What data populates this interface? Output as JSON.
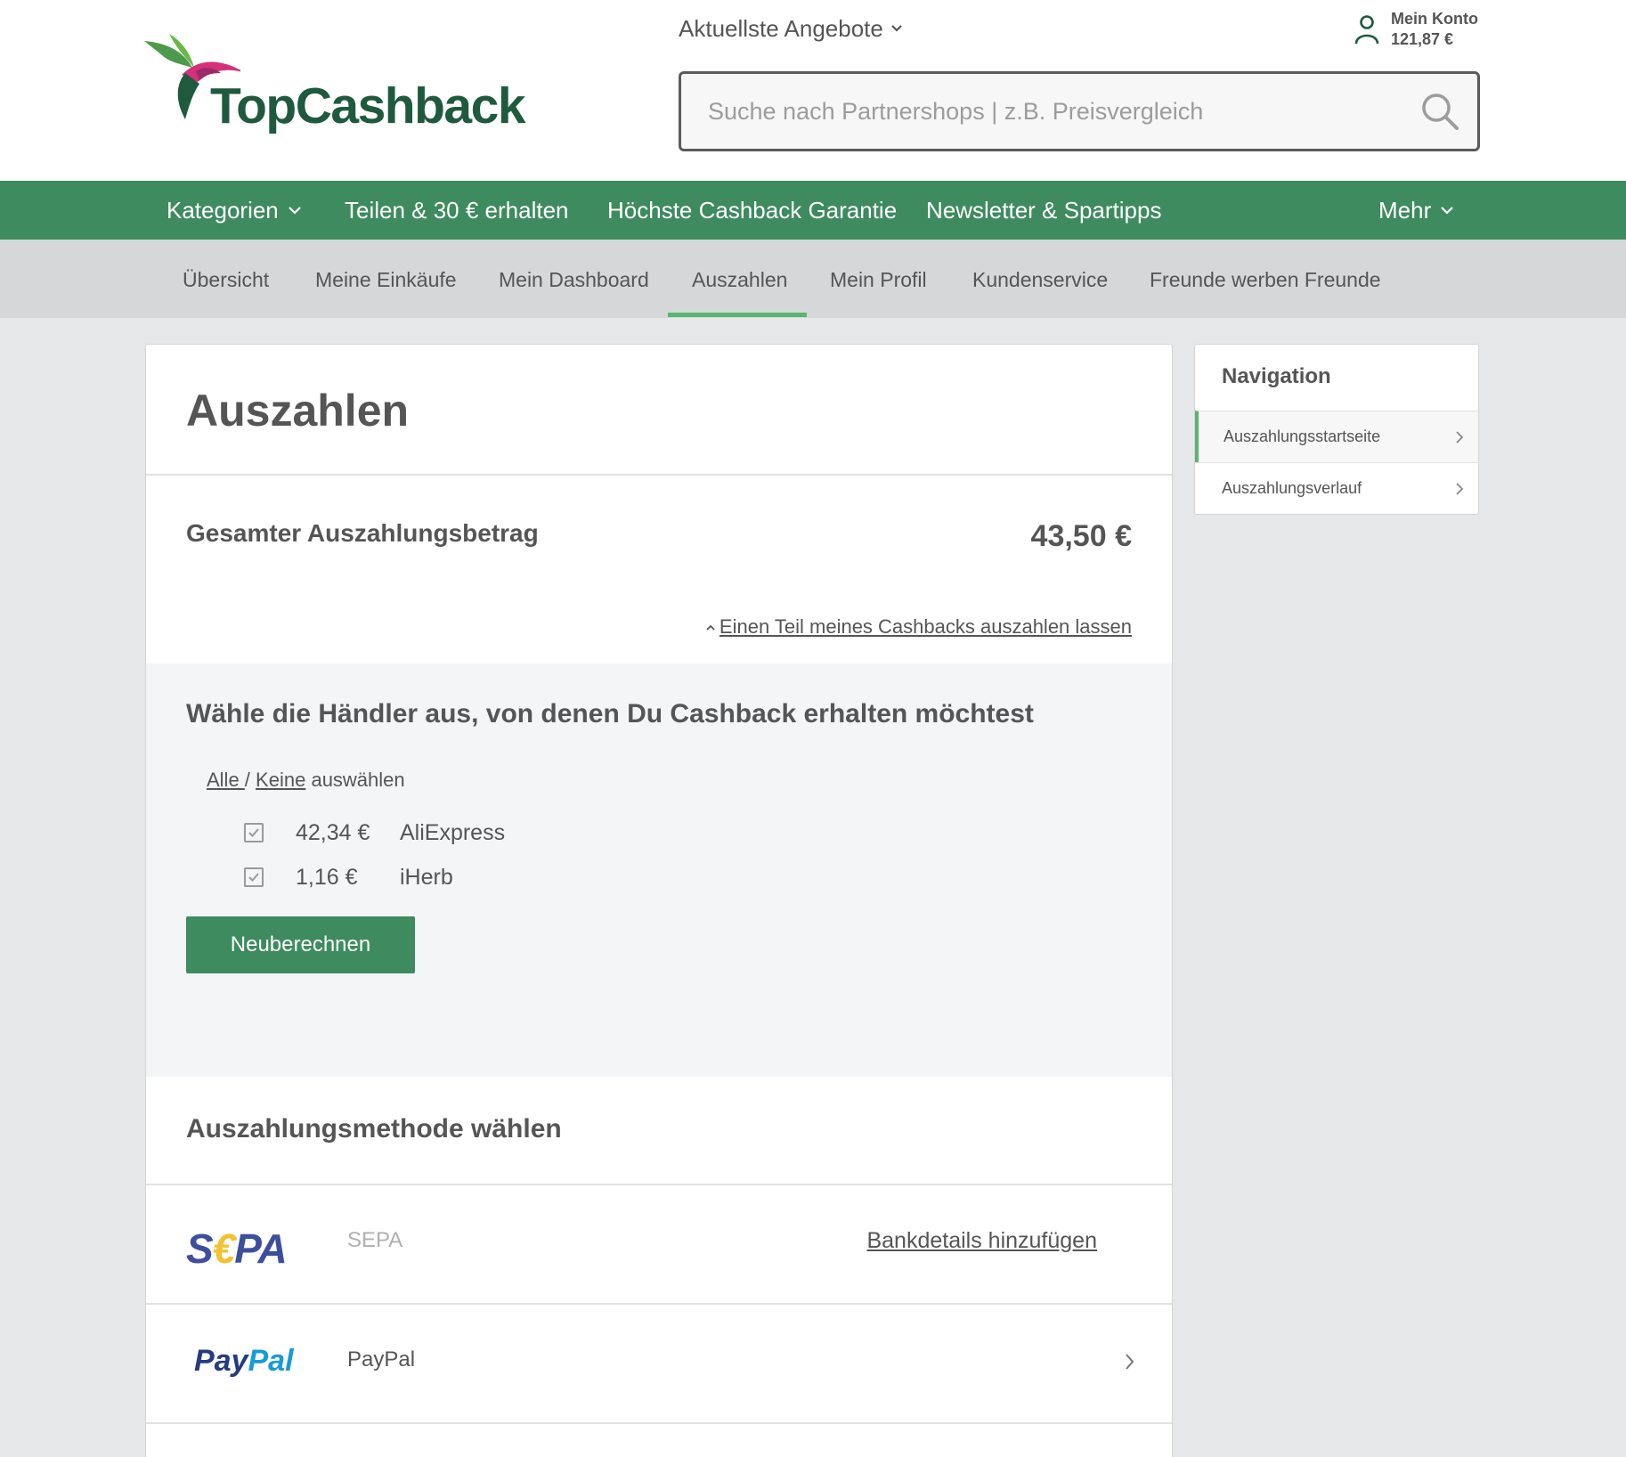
{
  "header": {
    "logo_text": "TopCashback",
    "offers_label": "Aktuellste Angebote",
    "account_label": "Mein Konto",
    "account_balance": "121,87 €",
    "search_placeholder": "Suche nach Partnershops | z.B. Preisvergleich"
  },
  "main_nav": {
    "items": [
      {
        "label": "Kategorien"
      },
      {
        "label": "Teilen & 30 € erhalten"
      },
      {
        "label": "Höchste Cashback Garantie"
      },
      {
        "label": "Newsletter & Spartipps"
      },
      {
        "label": "Mehr"
      }
    ]
  },
  "sub_nav": {
    "items": [
      {
        "label": "Übersicht"
      },
      {
        "label": "Meine Einkäufe"
      },
      {
        "label": "Mein Dashboard"
      },
      {
        "label": "Auszahlen"
      },
      {
        "label": "Mein Profil"
      },
      {
        "label": "Kundenservice"
      },
      {
        "label": "Freunde werben Freunde"
      }
    ],
    "active": "Auszahlen"
  },
  "payout": {
    "title": "Auszahlen",
    "total_label": "Gesamter Auszahlungsbetrag",
    "total_amount": "43,50 €",
    "partial_link": "Einen Teil meines Cashbacks auszahlen lassen",
    "merchant_heading": "Wähle die Händler aus, von denen Du Cashback erhalten möchtest",
    "select_all": "Alle ",
    "select_separator": "/",
    "select_none": "Keine",
    "select_suffix": "auswählen",
    "merchants": [
      {
        "amount": "42,34 €",
        "name": "AliExpress",
        "checked": true
      },
      {
        "amount": "1,16 €",
        "name": "iHerb",
        "checked": true
      }
    ],
    "recalc_button": "Neuberechnen",
    "method_heading": "Auszahlungsmethode wählen",
    "methods": [
      {
        "logo_text_1": "S",
        "logo_text_2": "€",
        "logo_text_3": "PA",
        "name": "SEPA",
        "action": "Bankdetails hinzufügen"
      },
      {
        "logo_text_1": "Pay",
        "logo_text_2": "Pal",
        "name": "PayPal"
      }
    ]
  },
  "side_nav": {
    "title": "Navigation",
    "items": [
      {
        "label": "Auszahlungsstartseite"
      },
      {
        "label": "Auszahlungsverlauf"
      }
    ]
  },
  "colors": {
    "brand_green": "#3d8b5f",
    "active_tab": "#59b56f",
    "sepa_blue": "#3d4f9c",
    "sepa_yellow": "#f2c230",
    "paypal_dark": "#253b80",
    "paypal_light": "#179bd7"
  }
}
